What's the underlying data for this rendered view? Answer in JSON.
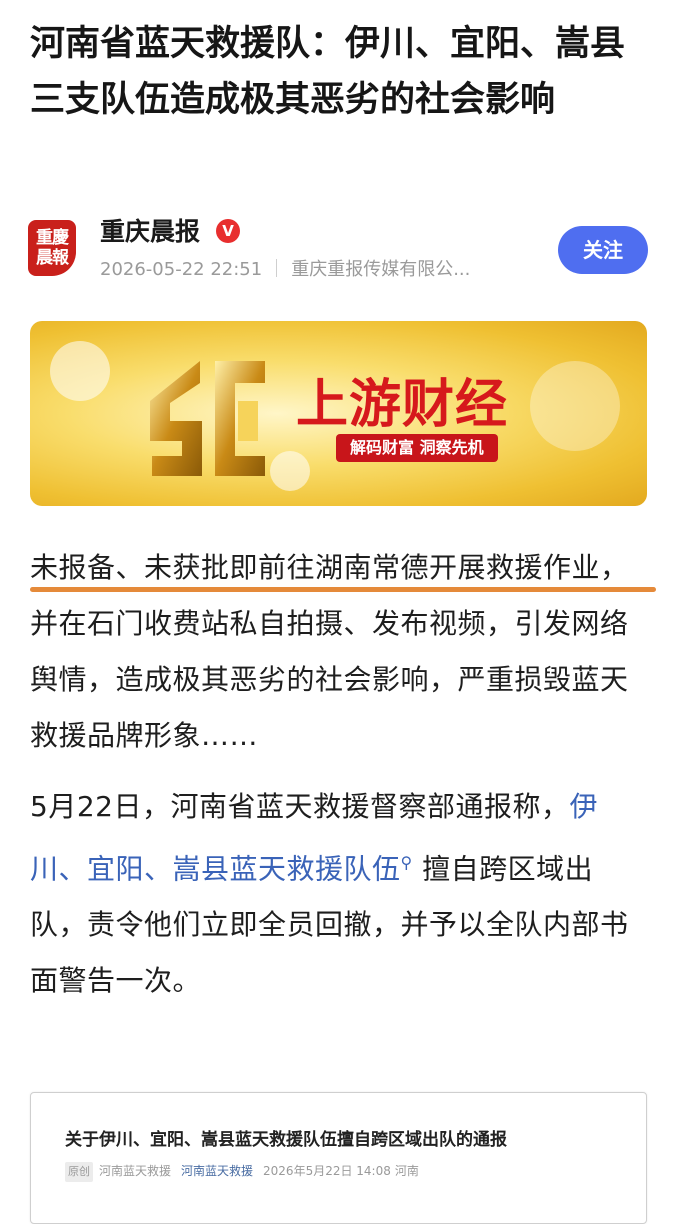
{
  "article": {
    "title": "河南省蓝天救援队：伊川、宜阳、嵩县三支队伍造成极其恶劣的社会影响"
  },
  "source": {
    "avatar_line1": "重慶",
    "avatar_line2": "晨報",
    "name": "重庆晨报",
    "verified_mark": "V",
    "datetime": "2026-05-22 22:51",
    "publisher": "重庆重报传媒有限公...",
    "follow_label": "关注"
  },
  "banner": {
    "title": "上游财经",
    "subtitle": "解码财富  洞察先机",
    "accent": "#d6191c"
  },
  "body": {
    "p1_underlined": "未报备、未获批即前往湖南常德开展救援作业，",
    "p1_rest": "并在石门收费站私自拍摄、发布视频，引发网络舆情，造成极其恶劣的社会影响，严重损毁蓝天救援品牌形象……",
    "p2_start": "5月22日，河南省蓝天救援督察部通报称，",
    "p2_link": "伊川、宜阳、嵩县蓝天救援队伍",
    "p2_end": " 擅自跨区域出队，责令他们立即全员回撤，并予以全队内部书面警告一次。"
  },
  "embedded_card": {
    "title": "关于伊川、宜阳、嵩县蓝天救援队伍擅自跨区域出队的通报",
    "tag": "原创",
    "author": "河南蓝天救援",
    "account": "河南蓝天救援",
    "datetime": "2026年5月22日 14:08",
    "location": "河南"
  },
  "colors": {
    "follow_button": "#4f6ef0",
    "link": "#3a63b8",
    "underline": "#e58a3a"
  }
}
